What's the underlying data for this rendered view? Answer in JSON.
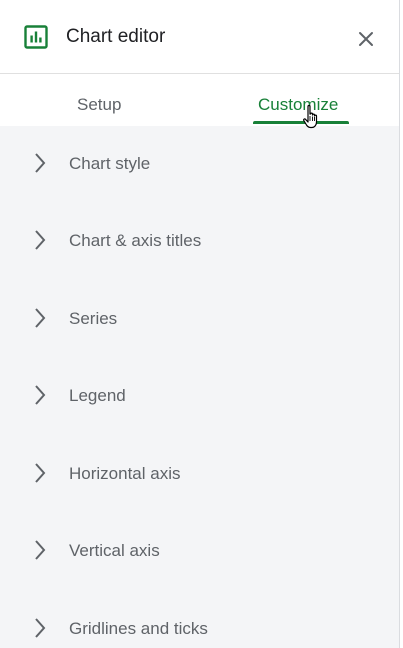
{
  "header": {
    "title": "Chart editor",
    "icon": "bar-chart-icon",
    "close_icon": "close-icon",
    "accent_color": "#188038"
  },
  "tabs": [
    {
      "label": "Setup",
      "active": false
    },
    {
      "label": "Customize",
      "active": true
    }
  ],
  "sections": [
    {
      "label": "Chart style",
      "icon": "chevron-right-icon"
    },
    {
      "label": "Chart & axis titles",
      "icon": "chevron-right-icon"
    },
    {
      "label": "Series",
      "icon": "chevron-right-icon"
    },
    {
      "label": "Legend",
      "icon": "chevron-right-icon"
    },
    {
      "label": "Horizontal axis",
      "icon": "chevron-right-icon"
    },
    {
      "label": "Vertical axis",
      "icon": "chevron-right-icon"
    },
    {
      "label": "Gridlines and ticks",
      "icon": "chevron-right-icon"
    }
  ]
}
